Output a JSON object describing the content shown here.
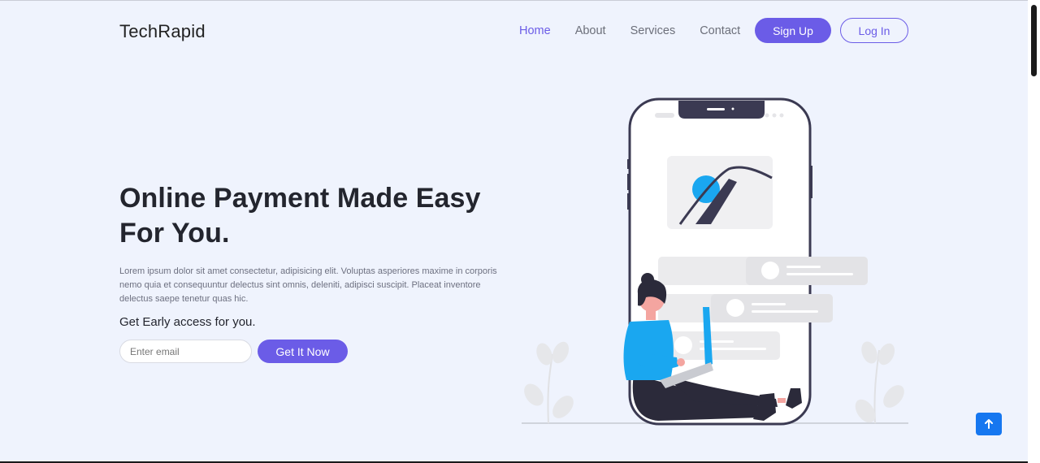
{
  "brand": "TechRapid",
  "nav": {
    "links": [
      "Home",
      "About",
      "Services",
      "Contact"
    ],
    "active": "Home",
    "signup_label": "Sign Up",
    "login_label": "Log In"
  },
  "hero": {
    "title": "Online Payment Made Easy For You.",
    "description": "Lorem ipsum dolor sit amet consectetur, adipisicing elit. Voluptas asperiores maxime in corporis nemo quia et consequuntur delectus sint omnis, deleniti, adipisci suscipit. Placeat inventore delectus saepe tenetur quas hic.",
    "subtitle": "Get Early access for you.",
    "email_placeholder": "Enter email",
    "email_value": "",
    "cta_label": "Get It Now"
  },
  "colors": {
    "accent": "#6b5ce7",
    "background": "#eff3fd",
    "scroll_top_button": "#1677f0"
  },
  "icons": {
    "scroll_top": "arrow-up-icon"
  }
}
